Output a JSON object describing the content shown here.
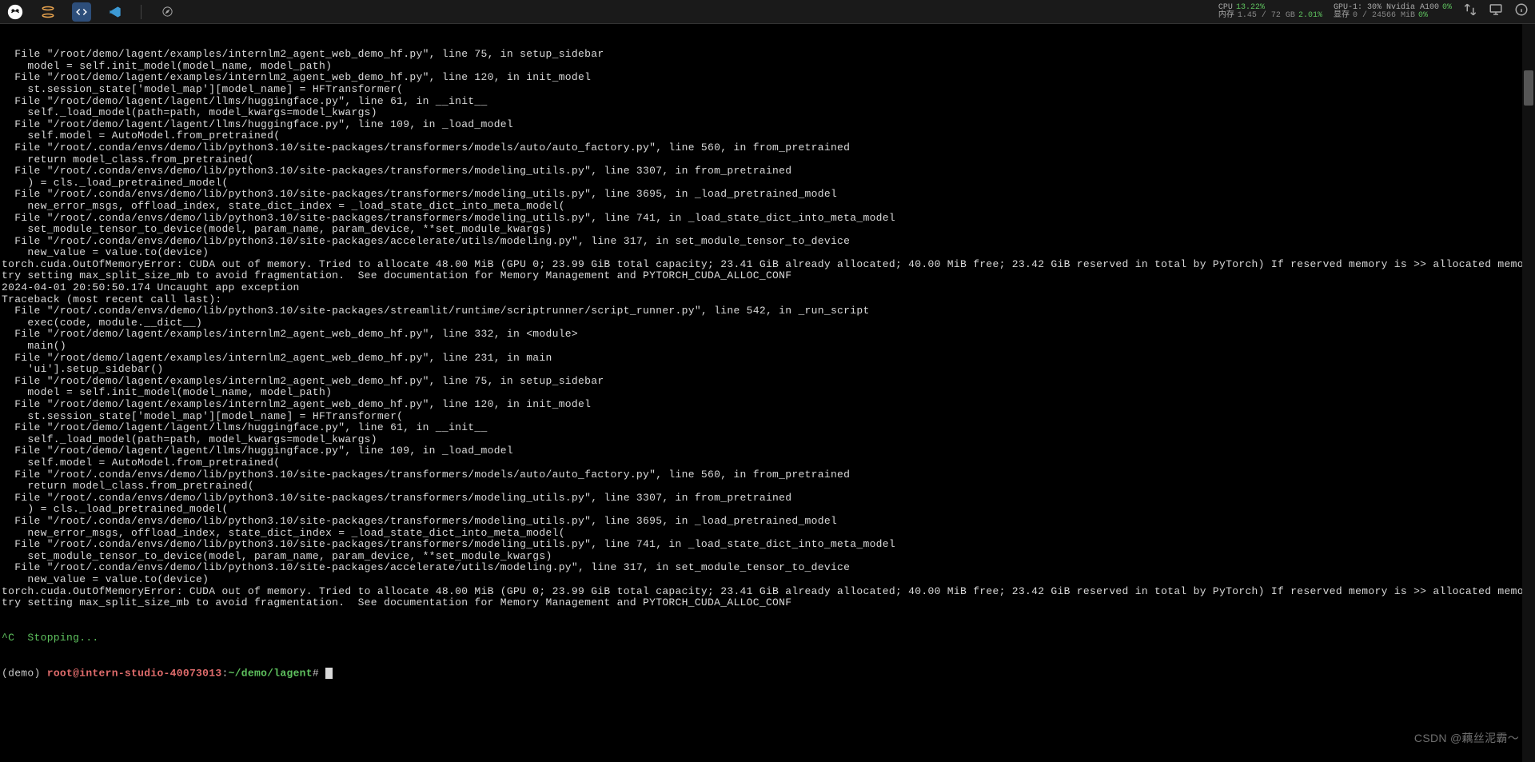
{
  "toolbar": {
    "stats": {
      "cpu_label": "CPU",
      "cpu_pct": "13.22%",
      "mem_label": "内存",
      "mem_used": "1.45 / 72 GB",
      "mem_pct": "2.01%",
      "gpu_label": "GPU-1: 30% Nvidia A100",
      "gpu_pct": "0%",
      "vram_label": "显存",
      "vram_used": "0 / 24566 MiB",
      "vram_pct": "0%"
    }
  },
  "terminal_lines": [
    "  File \"/root/demo/lagent/examples/internlm2_agent_web_demo_hf.py\", line 75, in setup_sidebar",
    "    model = self.init_model(model_name, model_path)",
    "  File \"/root/demo/lagent/examples/internlm2_agent_web_demo_hf.py\", line 120, in init_model",
    "    st.session_state['model_map'][model_name] = HFTransformer(",
    "  File \"/root/demo/lagent/lagent/llms/huggingface.py\", line 61, in __init__",
    "    self._load_model(path=path, model_kwargs=model_kwargs)",
    "  File \"/root/demo/lagent/lagent/llms/huggingface.py\", line 109, in _load_model",
    "    self.model = AutoModel.from_pretrained(",
    "  File \"/root/.conda/envs/demo/lib/python3.10/site-packages/transformers/models/auto/auto_factory.py\", line 560, in from_pretrained",
    "    return model_class.from_pretrained(",
    "  File \"/root/.conda/envs/demo/lib/python3.10/site-packages/transformers/modeling_utils.py\", line 3307, in from_pretrained",
    "    ) = cls._load_pretrained_model(",
    "  File \"/root/.conda/envs/demo/lib/python3.10/site-packages/transformers/modeling_utils.py\", line 3695, in _load_pretrained_model",
    "    new_error_msgs, offload_index, state_dict_index = _load_state_dict_into_meta_model(",
    "  File \"/root/.conda/envs/demo/lib/python3.10/site-packages/transformers/modeling_utils.py\", line 741, in _load_state_dict_into_meta_model",
    "    set_module_tensor_to_device(model, param_name, param_device, **set_module_kwargs)",
    "  File \"/root/.conda/envs/demo/lib/python3.10/site-packages/accelerate/utils/modeling.py\", line 317, in set_module_tensor_to_device",
    "    new_value = value.to(device)",
    "torch.cuda.OutOfMemoryError: CUDA out of memory. Tried to allocate 48.00 MiB (GPU 0; 23.99 GiB total capacity; 23.41 GiB already allocated; 40.00 MiB free; 23.42 GiB reserved in total by PyTorch) If reserved memory is >> allocated memory",
    "try setting max_split_size_mb to avoid fragmentation.  See documentation for Memory Management and PYTORCH_CUDA_ALLOC_CONF",
    "2024-04-01 20:50:50.174 Uncaught app exception",
    "Traceback (most recent call last):",
    "  File \"/root/.conda/envs/demo/lib/python3.10/site-packages/streamlit/runtime/scriptrunner/script_runner.py\", line 542, in _run_script",
    "    exec(code, module.__dict__)",
    "  File \"/root/demo/lagent/examples/internlm2_agent_web_demo_hf.py\", line 332, in <module>",
    "    main()",
    "  File \"/root/demo/lagent/examples/internlm2_agent_web_demo_hf.py\", line 231, in main",
    "    'ui'].setup_sidebar()",
    "  File \"/root/demo/lagent/examples/internlm2_agent_web_demo_hf.py\", line 75, in setup_sidebar",
    "    model = self.init_model(model_name, model_path)",
    "  File \"/root/demo/lagent/examples/internlm2_agent_web_demo_hf.py\", line 120, in init_model",
    "    st.session_state['model_map'][model_name] = HFTransformer(",
    "  File \"/root/demo/lagent/lagent/llms/huggingface.py\", line 61, in __init__",
    "    self._load_model(path=path, model_kwargs=model_kwargs)",
    "  File \"/root/demo/lagent/lagent/llms/huggingface.py\", line 109, in _load_model",
    "    self.model = AutoModel.from_pretrained(",
    "  File \"/root/.conda/envs/demo/lib/python3.10/site-packages/transformers/models/auto/auto_factory.py\", line 560, in from_pretrained",
    "    return model_class.from_pretrained(",
    "  File \"/root/.conda/envs/demo/lib/python3.10/site-packages/transformers/modeling_utils.py\", line 3307, in from_pretrained",
    "    ) = cls._load_pretrained_model(",
    "  File \"/root/.conda/envs/demo/lib/python3.10/site-packages/transformers/modeling_utils.py\", line 3695, in _load_pretrained_model",
    "    new_error_msgs, offload_index, state_dict_index = _load_state_dict_into_meta_model(",
    "  File \"/root/.conda/envs/demo/lib/python3.10/site-packages/transformers/modeling_utils.py\", line 741, in _load_state_dict_into_meta_model",
    "    set_module_tensor_to_device(model, param_name, param_device, **set_module_kwargs)",
    "  File \"/root/.conda/envs/demo/lib/python3.10/site-packages/accelerate/utils/modeling.py\", line 317, in set_module_tensor_to_device",
    "    new_value = value.to(device)",
    "torch.cuda.OutOfMemoryError: CUDA out of memory. Tried to allocate 48.00 MiB (GPU 0; 23.99 GiB total capacity; 23.41 GiB already allocated; 40.00 MiB free; 23.42 GiB reserved in total by PyTorch) If reserved memory is >> allocated memory",
    "try setting max_split_size_mb to avoid fragmentation.  See documentation for Memory Management and PYTORCH_CUDA_ALLOC_CONF"
  ],
  "stopping_line": "^C  Stopping...",
  "prompt": {
    "env": "(demo) ",
    "user": "root@intern-studio-40073013",
    "colon": ":",
    "path": "~/demo/lagent",
    "hash": "# "
  },
  "watermark": "CSDN @藕丝泥霸～"
}
